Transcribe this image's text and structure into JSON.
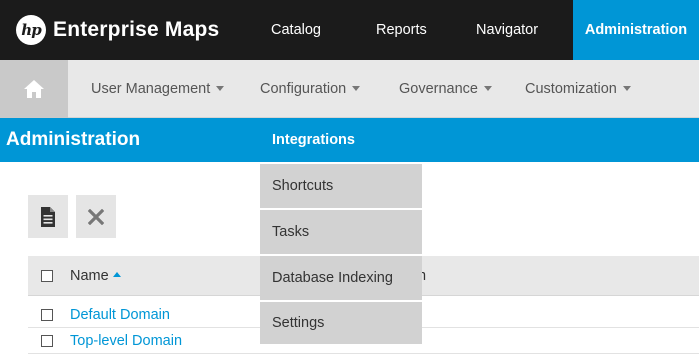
{
  "app": {
    "logo_mark": "hp",
    "name": "Enterprise Maps",
    "accent_color": "#0096d6",
    "topbar_color": "#1b1b1b"
  },
  "top_nav": [
    {
      "label": "Catalog",
      "active": false
    },
    {
      "label": "Reports",
      "active": false
    },
    {
      "label": "Navigator",
      "active": false
    },
    {
      "label": "Administration",
      "active": true
    }
  ],
  "sub_nav": {
    "home_icon": "home-icon",
    "items": [
      {
        "label": "User Management",
        "has_dropdown": true
      },
      {
        "label": "Configuration",
        "has_dropdown": true,
        "expanded": true
      },
      {
        "label": "Governance",
        "has_dropdown": true
      },
      {
        "label": "Customization",
        "has_dropdown": true
      }
    ]
  },
  "page": {
    "title": "Administration"
  },
  "toolbar": {
    "new_icon": "document-icon",
    "delete_icon": "close-icon"
  },
  "table": {
    "columns": [
      {
        "label": "Name",
        "sorted": "ascending"
      },
      {
        "label": "n",
        "partially_hidden": true
      }
    ],
    "rows": [
      {
        "name": "Default Domain"
      },
      {
        "name": "Top-level Domain"
      }
    ]
  },
  "configuration_menu": {
    "items": [
      {
        "label": "Integrations",
        "highlighted": true
      },
      {
        "label": "Shortcuts"
      },
      {
        "label": "Tasks"
      },
      {
        "label": "Database Indexing"
      },
      {
        "label": "Settings"
      }
    ]
  }
}
